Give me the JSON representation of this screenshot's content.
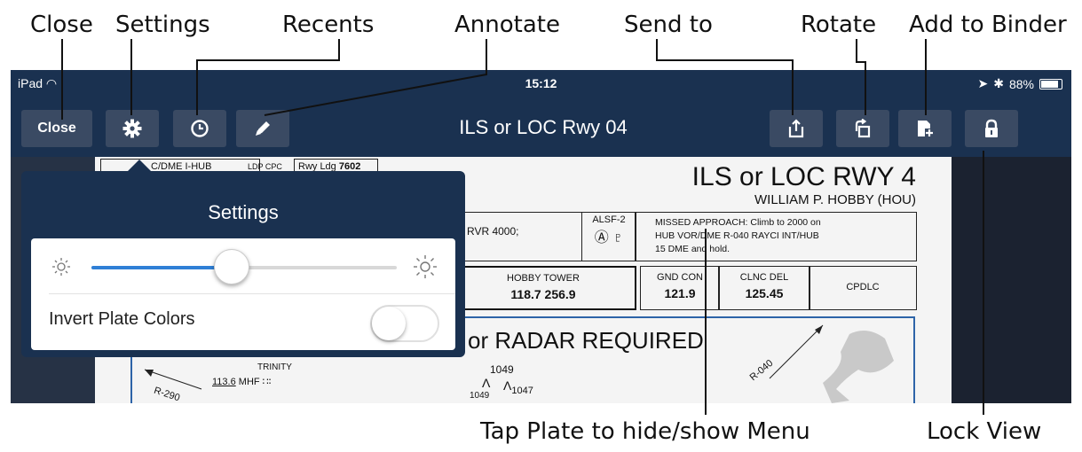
{
  "callouts": {
    "close": "Close",
    "settings": "Settings",
    "recents": "Recents",
    "annotate": "Annotate",
    "send_to": "Send to",
    "rotate": "Rotate",
    "add_to_binder": "Add to Binder",
    "tap_plate": "Tap Plate to hide/show Menu",
    "lock_view": "Lock View"
  },
  "status_bar": {
    "device": "iPad",
    "time": "15:12",
    "battery": "88%"
  },
  "toolbar": {
    "close_label": "Close",
    "title": "ILS or LOC Rwy 04"
  },
  "plate": {
    "top_left_box": "C/DME I-HUB",
    "top_left_box2": "LDP CPC",
    "rwy_ldg_label": "Rwy Ldg",
    "rwy_ldg_value": "7602",
    "title": "ILS or LOC RWY 4",
    "airport": "WILLIAM P. HOBBY (HOU)",
    "rvr": "o RVR 4000;",
    "alsf": "ALSF-2",
    "missed_approach_line1": "MISSED APPROACH: Climb to 2000 on",
    "missed_approach_line2": "HUB VOR/DME R-040 RAYCI INT/HUB",
    "missed_approach_line3": "15 DME and hold.",
    "hobby_tower_label": "HOBBY TOWER",
    "hobby_tower_freq": "118.7 256.9",
    "gnd_con_label": "GND CON",
    "gnd_con_freq": "121.9",
    "clnc_del_label": "CLNC DEL",
    "clnc_del_freq": "125.45",
    "cpdlc": "CPDLC",
    "radar_required": "or RADAR REQUIRED",
    "trinity": "TRINITY",
    "mhf_freq": "113.6",
    "mhf": "MHF",
    "radial_290": "R-290",
    "elev_1049": "1049",
    "elev_1047": "1047",
    "elev_1049b": "1049",
    "radial_040": "R-040"
  },
  "settings_popover": {
    "title": "Settings",
    "brightness": 0.46,
    "invert_label": "Invert Plate Colors",
    "invert_on": false
  },
  "colors": {
    "toolbar_bg": "#1a3150",
    "button_bg": "#3a4a63",
    "slider_fill": "#2f7fd6"
  }
}
